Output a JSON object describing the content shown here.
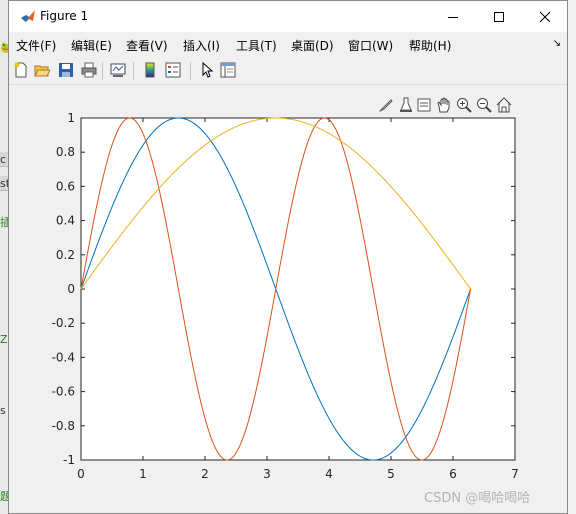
{
  "window": {
    "title": "Figure 1",
    "controls": [
      "minimize",
      "maximize",
      "close"
    ]
  },
  "menu": [
    {
      "label": "文件(F)"
    },
    {
      "label": "编辑(E)"
    },
    {
      "label": "查看(V)"
    },
    {
      "label": "插入(I)"
    },
    {
      "label": "工具(T)"
    },
    {
      "label": "桌面(D)"
    },
    {
      "label": "窗口(W)"
    },
    {
      "label": "帮助(H)"
    }
  ],
  "toolbar_icons": [
    "new-figure-icon",
    "open-file-icon",
    "save-icon",
    "print-icon",
    "link-plot-icon",
    "insert-colorbar-icon",
    "insert-legend-icon",
    "edit-plot-icon",
    "property-inspector-icon"
  ],
  "axes_toolbar_icons": [
    "brush-icon",
    "data-tips-icon",
    "restore-view-icon",
    "pan-icon",
    "zoom-in-icon",
    "zoom-out-icon",
    "home-icon"
  ],
  "background_fragments": [
    "c",
    "st",
    "插",
    "Z",
    "s",
    "题"
  ],
  "watermark": "CSDN @喝哈喝哈",
  "chart_data": {
    "type": "line",
    "title": "",
    "xlabel": "",
    "ylabel": "",
    "xlim": [
      0,
      7
    ],
    "ylim": [
      -1,
      1
    ],
    "xticks": [
      "0",
      "1",
      "2",
      "3",
      "4",
      "5",
      "6",
      "7"
    ],
    "yticks": [
      "-1",
      "-0.8",
      "-0.6",
      "-0.4",
      "-0.2",
      "0",
      "0.2",
      "0.4",
      "0.6",
      "0.8",
      "1"
    ],
    "grid": false,
    "legend": false,
    "x_range": [
      0,
      6.2832
    ],
    "series": [
      {
        "expression": "sin(x)",
        "color": "#0072bd"
      },
      {
        "expression": "sin(2x)",
        "color": "#d95319"
      },
      {
        "expression": "sin(x/2)",
        "color": "#edb120"
      }
    ]
  }
}
